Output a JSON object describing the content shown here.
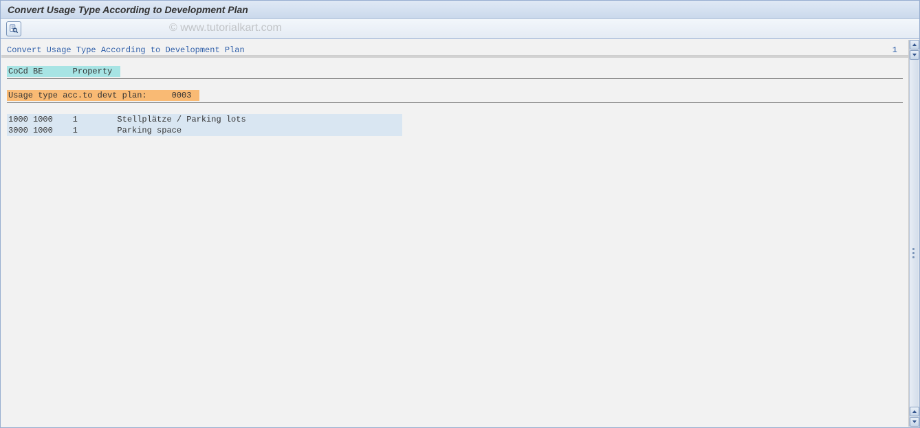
{
  "window": {
    "title": "Convert Usage Type According to Development Plan"
  },
  "watermark": "© www.tutorialkart.com",
  "content": {
    "section_title": "Convert Usage Type According to Development Plan",
    "page_number": "1",
    "col_header_cocd": "CoCd",
    "col_header_be": "BE",
    "col_header_property": "Property",
    "columns_display": "CoCd BE      Property",
    "usage_type_label": "Usage type acc.to devt plan:",
    "usage_type_value": "0003",
    "usage_type_display": "Usage type acc.to devt plan:     0003",
    "rows": [
      {
        "cocd": "1000",
        "be": "1000",
        "num": "1",
        "desc": "Stellplätze / Parking lots",
        "display": "1000 1000    1        Stellplätze / Parking lots"
      },
      {
        "cocd": "3000",
        "be": "1000",
        "num": "1",
        "desc": "Parking space",
        "display": "3000 1000    1        Parking space"
      }
    ]
  }
}
